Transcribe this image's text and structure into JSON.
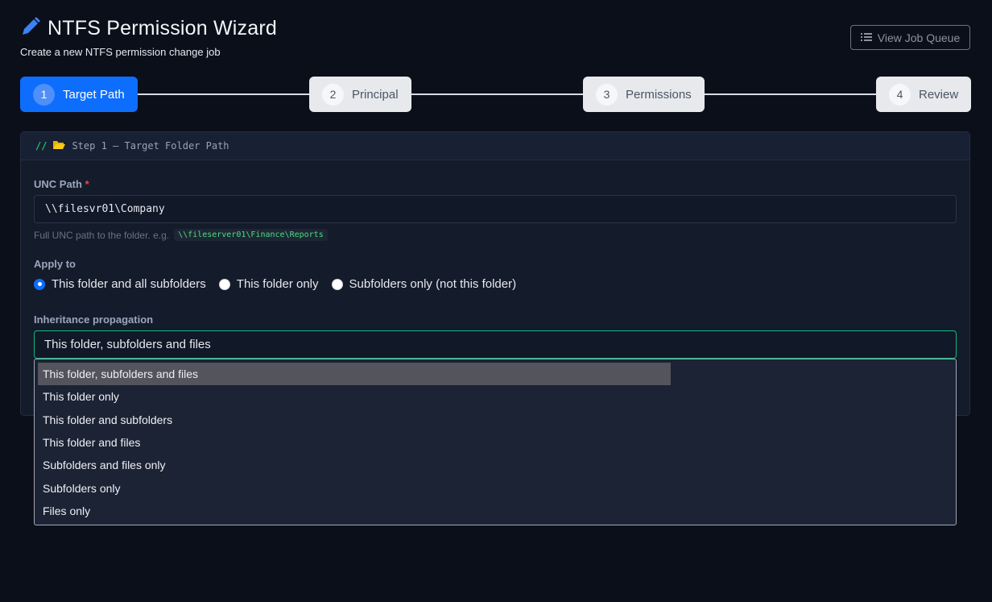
{
  "header": {
    "title": "NTFS Permission Wizard",
    "subtitle": "Create a new NTFS permission change job",
    "icon": "pencil-icon",
    "queue_button": "View Job Queue",
    "queue_icon": "list-icon"
  },
  "stepper": {
    "steps": [
      {
        "num": "1",
        "label": "Target Path"
      },
      {
        "num": "2",
        "label": "Principal"
      },
      {
        "num": "3",
        "label": "Permissions"
      },
      {
        "num": "4",
        "label": "Review"
      }
    ],
    "active_step": 1
  },
  "card": {
    "header_prefix": "//",
    "header_icon": "folder-icon",
    "header_title": "Step 1 — Target Folder Path",
    "unc_label": "UNC Path",
    "required_mark": "*",
    "unc_value": "\\\\filesvr01\\Company",
    "hint_text": "Full UNC path to the folder. e.g.",
    "hint_example": "\\\\fileserver01\\Finance\\Reports",
    "apply_label": "Apply to",
    "apply_options": [
      {
        "label": "This folder and all subfolders",
        "checked": true
      },
      {
        "label": "This folder only",
        "checked": false
      },
      {
        "label": "Subfolders only (not this folder)",
        "checked": false
      }
    ],
    "inherit_label": "Inheritance propagation",
    "inherit_value": "This folder, subfolders and files",
    "inherit_options": [
      "This folder, subfolders and files",
      "This folder only",
      "This folder and subfolders",
      "This folder and files",
      "Subfolders and files only",
      "Subfolders only",
      "Files only"
    ]
  },
  "colors": {
    "accent": "#0d6efd",
    "focus": "#10b981",
    "background": "#0b0f1a"
  }
}
